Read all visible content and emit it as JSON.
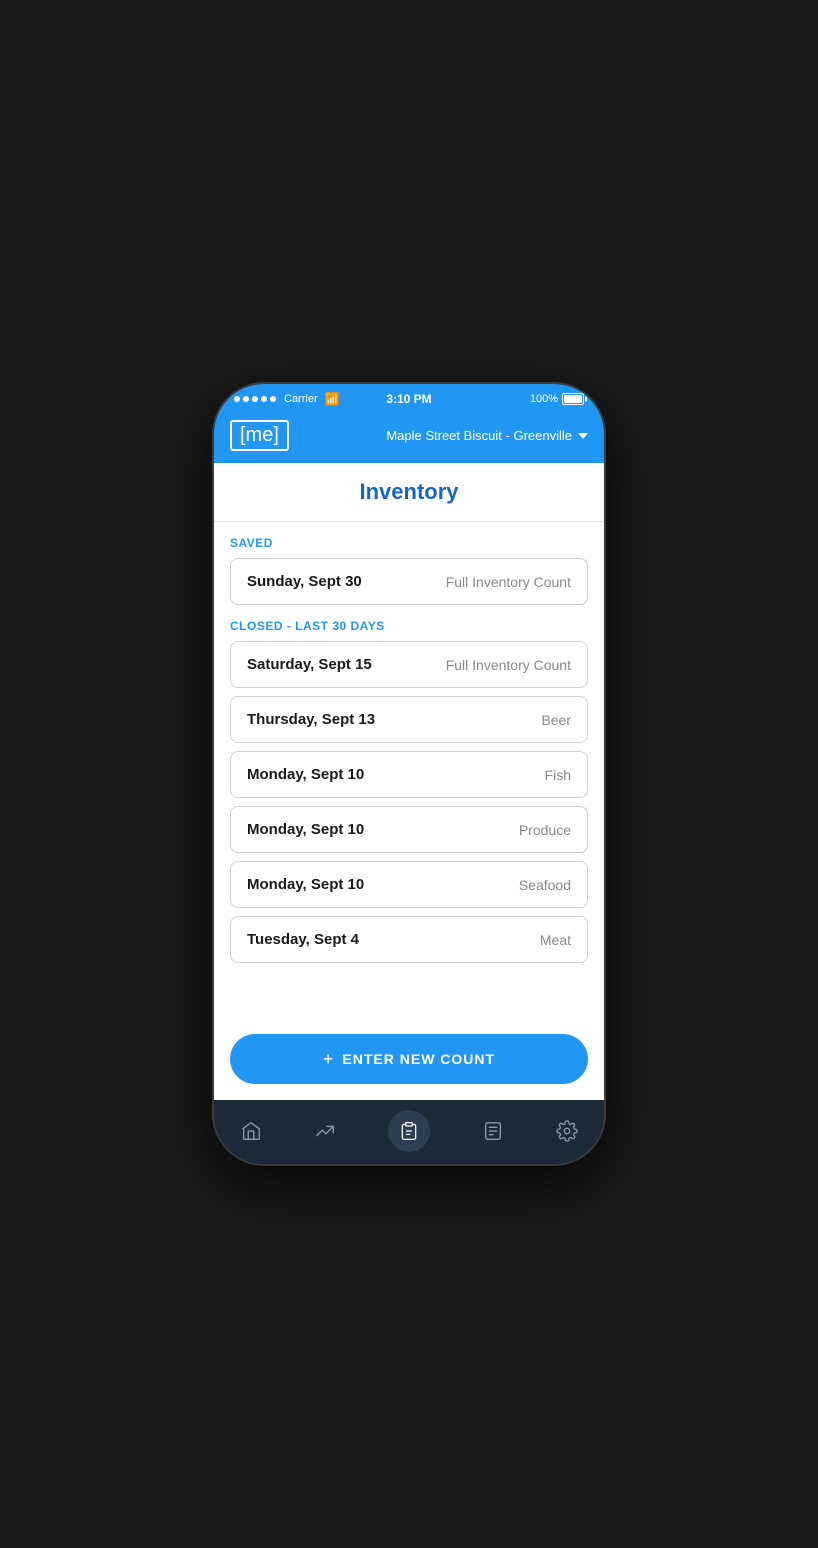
{
  "statusBar": {
    "carrier": "Carrier",
    "time": "3:10 PM",
    "battery": "100%"
  },
  "header": {
    "logo": "[me]",
    "location": "Maple Street Biscuit - Greenville"
  },
  "pageTitle": "Inventory",
  "savedSection": {
    "label": "SAVED",
    "items": [
      {
        "date": "Sunday, Sept 30",
        "type": "Full Inventory Count"
      }
    ]
  },
  "closedSection": {
    "label": "CLOSED - LAST 30 DAYS",
    "items": [
      {
        "date": "Saturday, Sept 15",
        "type": "Full Inventory Count"
      },
      {
        "date": "Thursday, Sept 13",
        "type": "Beer"
      },
      {
        "date": "Monday, Sept 10",
        "type": "Fish"
      },
      {
        "date": "Monday, Sept 10",
        "type": "Produce"
      },
      {
        "date": "Monday, Sept 10",
        "type": "Seafood"
      },
      {
        "date": "Tuesday, Sept 4",
        "type": "Meat"
      }
    ]
  },
  "actions": {
    "enterNewCount": "+ ENTER NEW COUNT"
  },
  "bottomNav": {
    "items": [
      {
        "id": "home",
        "label": "Home"
      },
      {
        "id": "analytics",
        "label": "Analytics"
      },
      {
        "id": "inventory",
        "label": "Inventory",
        "active": true
      },
      {
        "id": "orders",
        "label": "Orders"
      },
      {
        "id": "settings",
        "label": "Settings"
      }
    ]
  }
}
